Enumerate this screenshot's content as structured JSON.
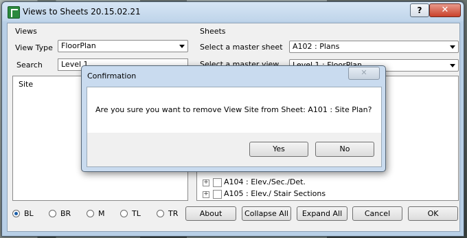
{
  "window": {
    "title": "Views to Sheets 20.15.02.21",
    "help_label": "?",
    "close_label": "✕"
  },
  "views": {
    "group_title": "Views",
    "view_type_label": "View Type",
    "view_type_value": "FloorPlan",
    "search_label": "Search",
    "search_value": "Level 1",
    "list_items": [
      "Site"
    ]
  },
  "sheets": {
    "group_title": "Sheets",
    "master_sheet_label": "Select  a  master  sheet",
    "master_sheet_value": "A102 : Plans",
    "master_view_label": "Select  a  master  view",
    "master_view_value": "Level 1 : FloorPlan",
    "tree_items": [
      {
        "label": "A104 : Elev./Sec./Det."
      },
      {
        "label": "A105 : Elev./ Stair Sections"
      }
    ]
  },
  "radios": {
    "options": [
      "BL",
      "BR",
      "M",
      "TL",
      "TR"
    ],
    "selected": "BL"
  },
  "buttons": {
    "about": "About",
    "collapse_all": "Collapse All",
    "expand_all": "Expand All",
    "cancel": "Cancel",
    "ok": "OK"
  },
  "dialog": {
    "title": "Confirmation",
    "close_label": "✕",
    "message": "Are you sure you want to remove View Site from Sheet: A101 : Site Plan?",
    "yes_label": "Yes",
    "no_label": "No"
  }
}
